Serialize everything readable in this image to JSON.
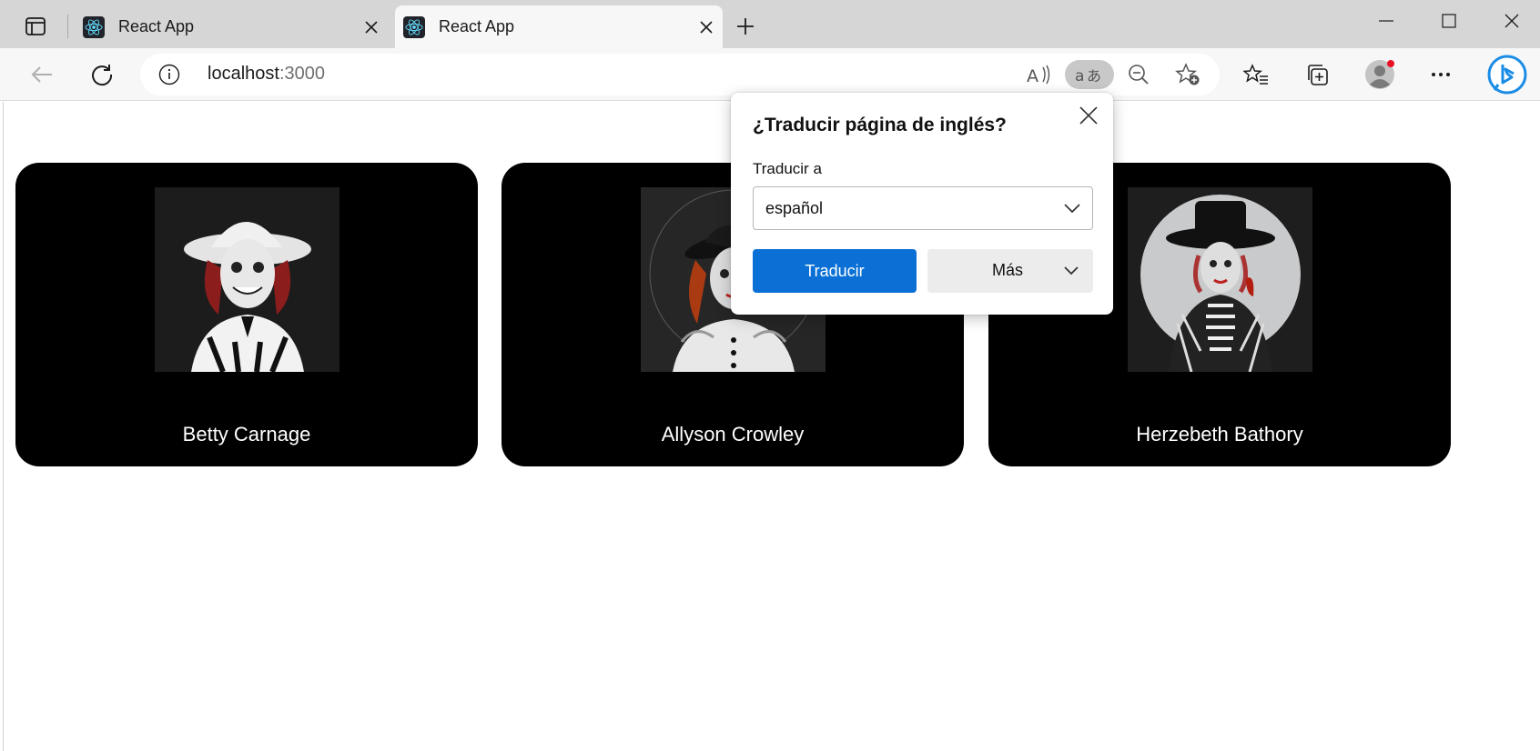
{
  "browser": {
    "tabs": [
      {
        "title": "React App",
        "active": false
      },
      {
        "title": "React App",
        "active": true
      }
    ],
    "address": {
      "host": "localhost",
      "port": ":3000"
    }
  },
  "translate_popup": {
    "title": "¿Traducir página de inglés?",
    "target_label": "Traducir a",
    "target_value": "español",
    "translate_button": "Traducir",
    "more_button": "Más"
  },
  "cards": [
    {
      "name": "Betty Carnage"
    },
    {
      "name": "Allyson Crowley"
    },
    {
      "name": "Herzebeth Bathory"
    }
  ],
  "colors": {
    "accent": "#0a70d6",
    "card_bg": "#000000",
    "tab_strip": "#d6d6d6"
  }
}
